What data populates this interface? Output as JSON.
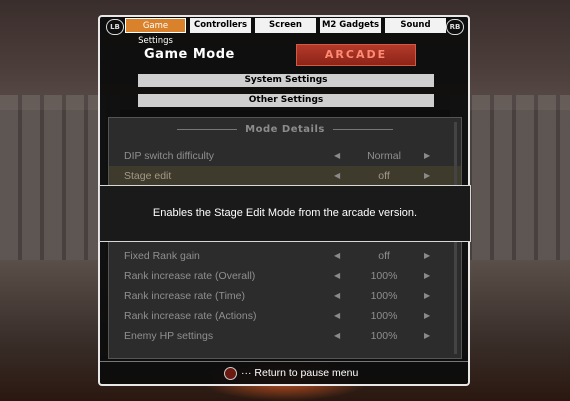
{
  "tabs": [
    {
      "label": "Game Settings",
      "active": true
    },
    {
      "label": "Controllers",
      "active": false
    },
    {
      "label": "Screen",
      "active": false
    },
    {
      "label": "M2 Gadgets",
      "active": false
    },
    {
      "label": "Sound",
      "active": false
    }
  ],
  "bumpers": {
    "left": "LB",
    "right": "RB"
  },
  "game_mode": {
    "label": "Game Mode",
    "value": "ARCADE"
  },
  "menu": {
    "system_settings": "System Settings",
    "other_settings": "Other Settings"
  },
  "details": {
    "title": "Mode Details",
    "rows": [
      {
        "label": "DIP switch difficulty",
        "value": "Normal"
      },
      {
        "label": "Stage edit",
        "value": "off"
      },
      {
        "label": "Fixed Rank gain",
        "value": "off"
      },
      {
        "label": "Rank increase rate (Overall)",
        "value": "100%"
      },
      {
        "label": "Rank increase rate (Time)",
        "value": "100%"
      },
      {
        "label": "Rank increase rate (Actions)",
        "value": "100%"
      },
      {
        "label": "Enemy HP settings",
        "value": "100%"
      }
    ]
  },
  "tooltip": "Enables the Stage Edit Mode from the arcade version.",
  "footer": {
    "text": "··· Return to pause menu"
  },
  "icons": {
    "arrow_left": "◀",
    "arrow_right": "▶"
  }
}
